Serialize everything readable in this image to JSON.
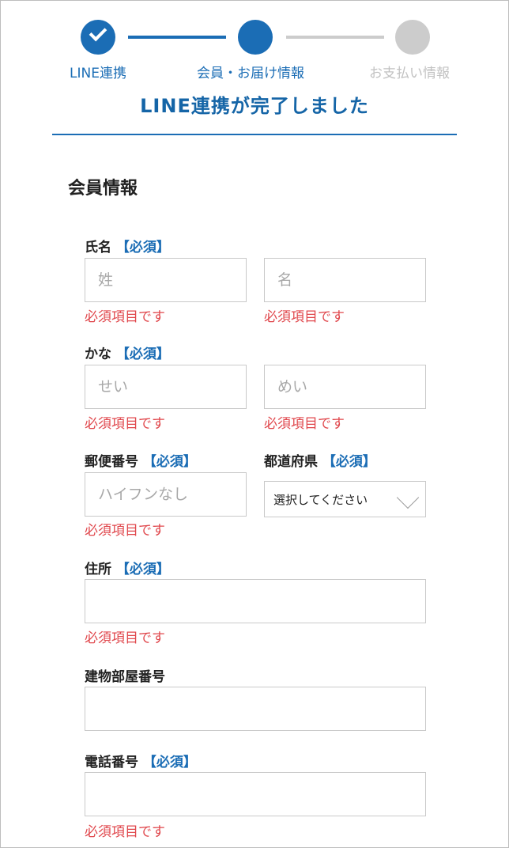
{
  "stepper": {
    "steps": [
      {
        "label": "LINE連携",
        "state": "done"
      },
      {
        "label": "会員・お届け情報",
        "state": "current"
      },
      {
        "label": "お支払い情報",
        "state": "pending"
      }
    ]
  },
  "colors": {
    "accent": "#1b6db5",
    "inactive": "#cccccc",
    "error": "#e0474c"
  },
  "header": {
    "title": "LINE連携が完了しました"
  },
  "form": {
    "section_title": "会員情報",
    "required_tag": "【必須】",
    "name": {
      "label": "氏名",
      "last_placeholder": "姓",
      "first_placeholder": "名",
      "last_value": "",
      "first_value": ""
    },
    "kana": {
      "label": "かな",
      "last_placeholder": "せい",
      "first_placeholder": "めい",
      "last_value": "",
      "first_value": ""
    },
    "postal": {
      "label": "郵便番号",
      "placeholder": "ハイフンなし",
      "value": ""
    },
    "prefecture": {
      "label": "都道府県",
      "selected": "選択してください"
    },
    "address": {
      "label": "住所",
      "value": ""
    },
    "building": {
      "label": "建物部屋番号",
      "value": ""
    },
    "phone": {
      "label": "電話番号",
      "value": ""
    },
    "error_message": "必須項目です"
  }
}
